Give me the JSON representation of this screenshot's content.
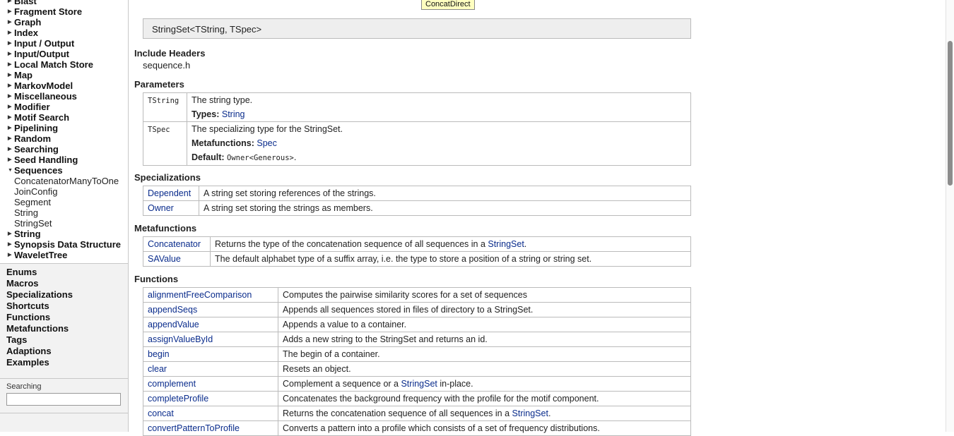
{
  "sidebar": {
    "tree": [
      {
        "label": "Blast",
        "expanded": false
      },
      {
        "label": "Fragment Store",
        "expanded": false
      },
      {
        "label": "Graph",
        "expanded": false
      },
      {
        "label": "Index",
        "expanded": false
      },
      {
        "label": "Input / Output",
        "expanded": false
      },
      {
        "label": "Input/Output",
        "expanded": false
      },
      {
        "label": "Local Match Store",
        "expanded": false
      },
      {
        "label": "Map",
        "expanded": false
      },
      {
        "label": "MarkovModel",
        "expanded": false
      },
      {
        "label": "Miscellaneous",
        "expanded": false
      },
      {
        "label": "Modifier",
        "expanded": false
      },
      {
        "label": "Motif Search",
        "expanded": false
      },
      {
        "label": "Pipelining",
        "expanded": false
      },
      {
        "label": "Random",
        "expanded": false
      },
      {
        "label": "Searching",
        "expanded": false
      },
      {
        "label": "Seed Handling",
        "expanded": false
      },
      {
        "label": "Sequences",
        "expanded": true
      },
      {
        "label": "ConcatenatorManyToOne",
        "child": true
      },
      {
        "label": "JoinConfig",
        "child": true
      },
      {
        "label": "Segment",
        "child": true
      },
      {
        "label": "String",
        "child": true
      },
      {
        "label": "StringSet",
        "child": true
      },
      {
        "label": "String",
        "expanded": false
      },
      {
        "label": "Synopsis Data Structure",
        "expanded": false
      },
      {
        "label": "WaveletTree",
        "expanded": false
      }
    ],
    "categories": [
      "Enums",
      "Macros",
      "Specializations",
      "Shortcuts",
      "Functions",
      "Metafunctions",
      "Tags",
      "Adaptions",
      "Examples"
    ],
    "search": {
      "label": "Searching",
      "value": ""
    }
  },
  "tooltip": "ConcatDirect",
  "signature": "StringSet<TString, TSpec>",
  "include": {
    "heading": "Include Headers",
    "file": "sequence.h"
  },
  "parameters": {
    "heading": "Parameters",
    "rows": [
      {
        "name": "TString",
        "desc": "The string type.",
        "extra": [
          {
            "label": "Types:",
            "value": "String",
            "link": true
          }
        ]
      },
      {
        "name": "TSpec",
        "desc": "The specializing type for the StringSet.",
        "extra": [
          {
            "label": "Metafunctions:",
            "value": "Spec",
            "link": true
          },
          {
            "label": "Default:",
            "value": "Owner<Generous>",
            "mono": true,
            "suffix": "."
          }
        ]
      }
    ]
  },
  "specializations": {
    "heading": "Specializations",
    "rows": [
      {
        "name": "Dependent",
        "desc": "A string set storing references of the strings."
      },
      {
        "name": "Owner",
        "desc": "A string set storing the strings as members."
      }
    ]
  },
  "metafunctions": {
    "heading": "Metafunctions",
    "rows": [
      {
        "name": "Concatenator",
        "desc": "Returns the type of the concatenation sequence of all sequences in a ",
        "link": "StringSet",
        "after": "."
      },
      {
        "name": "SAValue",
        "desc": "The default alphabet type of a suffix array, i.e. the type to store a position of a string or string set."
      }
    ]
  },
  "functions": {
    "heading": "Functions",
    "rows": [
      {
        "name": "alignmentFreeComparison",
        "desc": "Computes the pairwise similarity scores for a set of sequences"
      },
      {
        "name": "appendSeqs",
        "desc": "Appends all sequences stored in files of directory to a StringSet."
      },
      {
        "name": "appendValue",
        "desc": "Appends a value to a container."
      },
      {
        "name": "assignValueById",
        "desc": "Adds a new string to the StringSet and returns an id."
      },
      {
        "name": "begin",
        "desc": "The begin of a container."
      },
      {
        "name": "clear",
        "desc": "Resets an object."
      },
      {
        "name": "complement",
        "desc": "Complement a sequence or a ",
        "link": "StringSet",
        "after": " in-place."
      },
      {
        "name": "completeProfile",
        "desc": "Concatenates the background frequency with the profile for the motif component."
      },
      {
        "name": "concat",
        "desc": "Returns the concatenation sequence of all sequences in a ",
        "link": "StringSet",
        "after": "."
      },
      {
        "name": "convertPatternToProfile",
        "desc": "Converts a pattern into a profile which consists of a set of frequency distributions."
      }
    ]
  }
}
